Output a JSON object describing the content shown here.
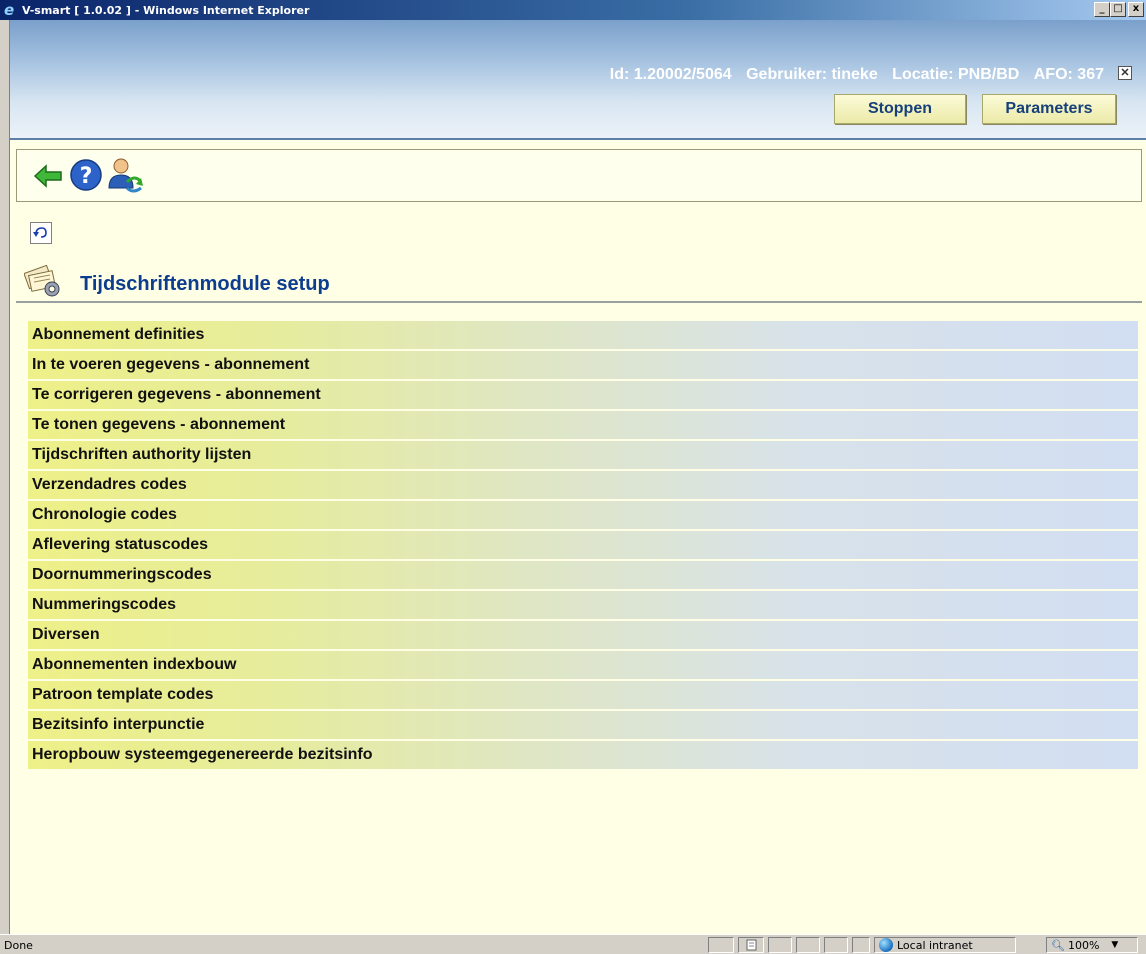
{
  "window": {
    "title": "V-smart [ 1.0.02 ] - Windows Internet Explorer",
    "minimize": "_",
    "maximize": "□",
    "close": "x"
  },
  "header": {
    "id_label": "Id: 1.20002/5064",
    "user_label": "Gebruiker: tineke",
    "location_label": "Locatie: PNB/BD",
    "afo_label": "AFO: 367",
    "close_glyph": "✕",
    "buttons": {
      "stop": "Stoppen",
      "parameters": "Parameters"
    }
  },
  "toolbar": {
    "icons": [
      "back-arrow-icon",
      "help-icon",
      "user-switch-icon"
    ]
  },
  "page": {
    "title": "Tijdschriftenmodule setup"
  },
  "menu": {
    "items": [
      "Abonnement definities",
      "In te voeren gegevens - abonnement",
      "Te corrigeren gegevens - abonnement",
      "Te tonen gegevens - abonnement",
      "Tijdschriften authority lijsten",
      "Verzendadres codes",
      "Chronologie codes",
      "Aflevering statuscodes",
      "Doornummeringscodes",
      "Nummeringscodes",
      "Diversen",
      "Abonnementen indexbouw",
      "Patroon template codes",
      "Bezitsinfo interpunctie",
      "Heropbouw systeemgegenereerde bezitsinfo"
    ]
  },
  "statusbar": {
    "status": "Done",
    "zone": "Local intranet",
    "zoom": "100%"
  },
  "colors": {
    "title_blue": "#0d3d8e",
    "button_text": "#17407a",
    "app_background": "#ffffe6"
  }
}
